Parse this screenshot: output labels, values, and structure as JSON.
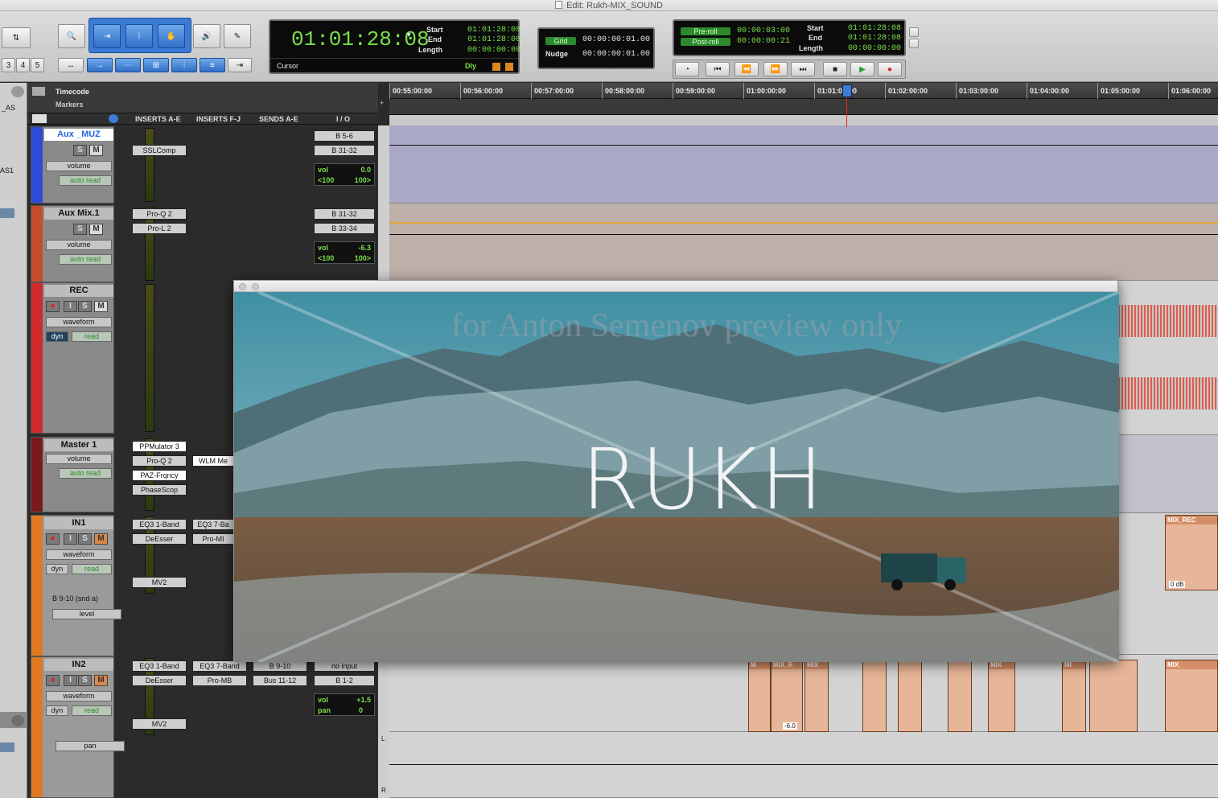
{
  "window": {
    "title": "Edit: Rukh-MIX_SOUND"
  },
  "toolbar": {
    "zoom_presets": [
      "3",
      "4",
      "5"
    ],
    "main_counter": "01:01:28:08",
    "cursor_label": "Cursor",
    "selection": {
      "start_label": "Start",
      "end_label": "End",
      "length_label": "Length",
      "start": "01:01:28:08",
      "end": "01:01:28:08",
      "length": "00:00:00:00"
    },
    "dly_label": "Dly",
    "grid": {
      "label": "Grid",
      "value": "00:00:00:01.00"
    },
    "nudge": {
      "label": "Nudge",
      "value": "00:00:00:01.00"
    },
    "preroll": {
      "label": "Pre-roll",
      "value": "00:00:03:00"
    },
    "postroll": {
      "label": "Post-roll",
      "value": "00:00:00:21"
    },
    "selection2": {
      "start": "01:01:28:08",
      "end": "01:01:28:08",
      "length": "00:00:00:00"
    }
  },
  "left_strip": {
    "items": [
      "_AS",
      "AS1"
    ]
  },
  "rulers": {
    "timecode_label": "Timecode",
    "markers_label": "Markers",
    "ticks": [
      "00:55:00:00",
      "00:56:00:00",
      "00:57:00:00",
      "00:58:00:00",
      "00:59:00:00",
      "01:00:00:00",
      "01:01:00:00",
      "01:02:00:00",
      "01:03:00:00",
      "01:04:00:00",
      "01:05:00:00",
      "01:06:00:00"
    ]
  },
  "mix_headers": [
    "INSERTS A-E",
    "INSERTS F-J",
    "SENDS A-E",
    "I / O"
  ],
  "tracks": [
    {
      "name": "Aux _MUZ",
      "view": "volume",
      "auto": "auto read",
      "inserts": [
        "SSLComp"
      ],
      "io_in": "B 5-6",
      "io_out": "B 31-32",
      "vol": "0.0",
      "pan_l": "<100",
      "pan_r": "100>",
      "color": "#2c4bd8"
    },
    {
      "name": "Aux Mix.1",
      "view": "volume",
      "auto": "auto read",
      "inserts": [
        "Pro-Q 2",
        "Pro-L 2"
      ],
      "io_in": "B 31-32",
      "io_out": "B 33-34",
      "vol": "-6.3",
      "pan_l": "<100",
      "pan_r": "100>",
      "color": "#c44c2c"
    },
    {
      "name": "REC",
      "view": "waveform",
      "dyn": "dyn",
      "auto": "read",
      "color": "#d12a2a"
    },
    {
      "name": "Master 1",
      "view": "volume",
      "auto": "auto read",
      "inserts": [
        "PPMulator 3",
        "Pro-Q 2",
        "PAZ-Frqncy",
        "PhaseScop"
      ],
      "inserts2": [
        "WLM Me"
      ],
      "color": "#7a1a1a"
    },
    {
      "name": "IN1",
      "view": "waveform",
      "dyn": "dyn",
      "auto": "read",
      "inserts": [
        "EQ3 1-Band",
        "DeEsser",
        "MV2"
      ],
      "inserts2": [
        "EQ3 7-Ba",
        "Pro-MI"
      ],
      "send": "B 9-10 (snd a)",
      "send_view": "level",
      "color": "#e07a22"
    },
    {
      "name": "IN2",
      "view": "waveform",
      "dyn": "dyn",
      "auto": "read",
      "inserts": [
        "EQ3 1-Band",
        "DeEsser",
        "MV2"
      ],
      "inserts2": [
        "EQ3 7-Band",
        "Pro-MB"
      ],
      "sends": [
        "B 9-10",
        "Bus 11-12"
      ],
      "io_in": "no input",
      "io_out": "B 1-2",
      "vol": "+1.5",
      "pan_label": "pan",
      "pan_val": "0",
      "send_view": "pan",
      "color": "#e07a22"
    }
  ],
  "clips": {
    "mix_rec": "MIX_REC",
    "mix_r": "MIX_R",
    "mix": "MIX",
    "mix2": "MIX",
    "mix3": "MIX_",
    "m": "M",
    "mi": "MI",
    "gain1": "-6.0",
    "gain2": "0 dB"
  },
  "lane_letters": {
    "l": "L",
    "r": "R"
  },
  "video": {
    "watermark": "for Anton Semenov preview only",
    "title": "RUKH"
  },
  "colors": {
    "lcd_green": "#7be04a",
    "selected_blue": "#2f6fc6",
    "clip_orange": "#e7b598"
  }
}
